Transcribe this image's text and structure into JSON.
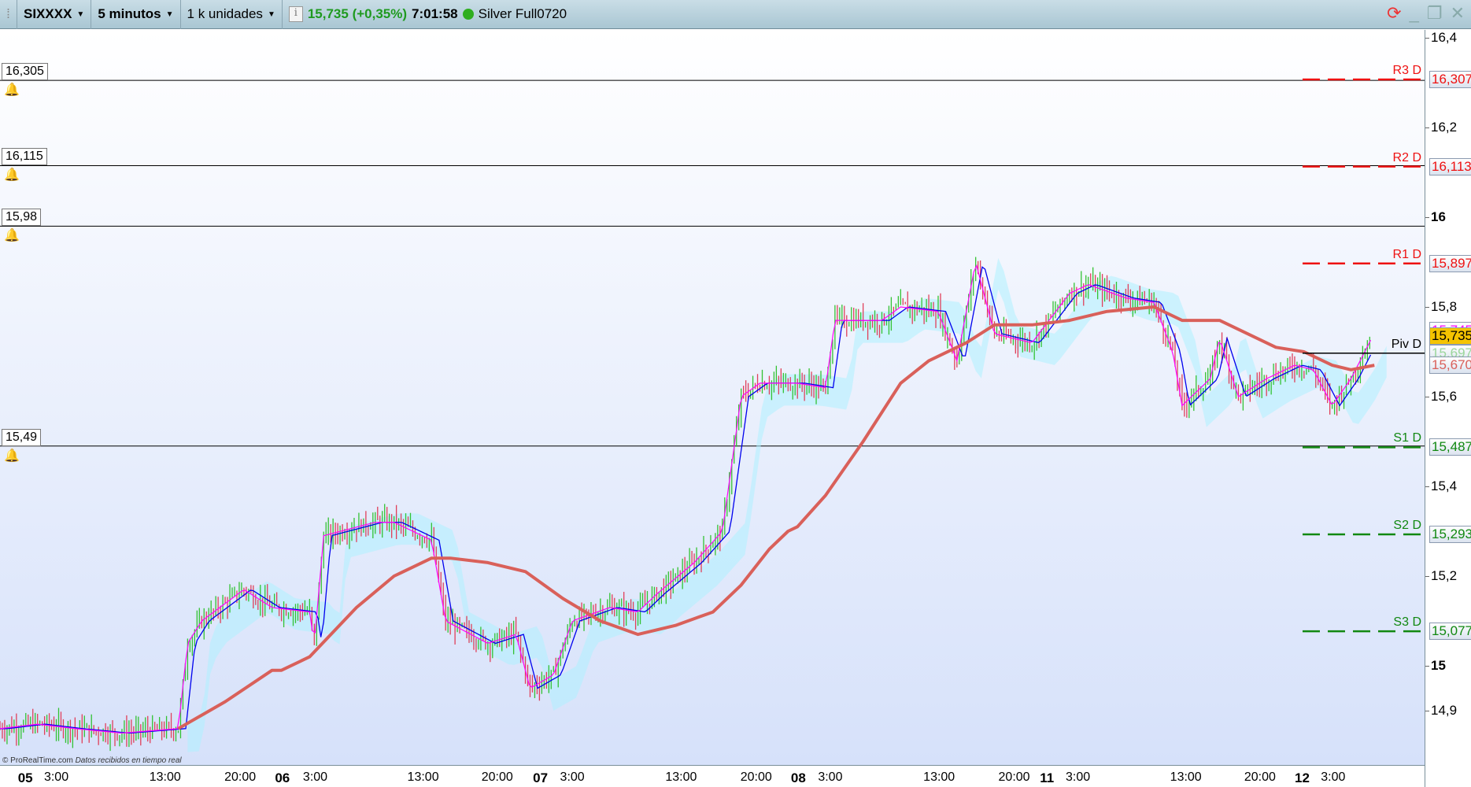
{
  "toolbar": {
    "symbol": "SIXXXX",
    "timeframe": "5 minutos",
    "units": "1 k unidades",
    "price": "15,735 (+0,35%)",
    "time": "7:01:58",
    "feed": "Silver Full0720"
  },
  "footer": {
    "copyright": "© ProRealTime.com",
    "realtime": "Datos recibidos en tiempo real"
  },
  "colors": {
    "up": "#33c233",
    "down": "#e0405a",
    "ma": "#d9605a",
    "fast": "#ff00ff",
    "slow": "#0000ee",
    "cloud": "#aef0ff",
    "resist": "#ee1111",
    "support": "#118811"
  },
  "chart_data": {
    "type": "candlestick",
    "ylim": [
      14.78,
      16.43
    ],
    "xlim": [
      0,
      1510
    ],
    "y_ticks": [
      "16,4",
      "16,2",
      "16",
      "15,8",
      "15,6",
      "15,4",
      "15,2",
      "15",
      "14,9"
    ],
    "y_tick_values": [
      16.4,
      16.2,
      16.0,
      15.8,
      15.6,
      15.4,
      15.2,
      15.0,
      14.9
    ],
    "x_ticks": [
      {
        "label": "05",
        "x": 27,
        "bold": true
      },
      {
        "label": "3:00",
        "x": 60
      },
      {
        "label": "13:00",
        "x": 176
      },
      {
        "label": "20:00",
        "x": 256
      },
      {
        "label": "06",
        "x": 301,
        "bold": true
      },
      {
        "label": "3:00",
        "x": 336
      },
      {
        "label": "13:00",
        "x": 451
      },
      {
        "label": "20:00",
        "x": 530
      },
      {
        "label": "07",
        "x": 576,
        "bold": true
      },
      {
        "label": "3:00",
        "x": 610
      },
      {
        "label": "13:00",
        "x": 726
      },
      {
        "label": "20:00",
        "x": 806
      },
      {
        "label": "08",
        "x": 851,
        "bold": true
      },
      {
        "label": "3:00",
        "x": 885
      },
      {
        "label": "13:00",
        "x": 1001
      },
      {
        "label": "20:00",
        "x": 1081
      },
      {
        "label": "11",
        "x": 1116,
        "bold": true
      },
      {
        "label": "3:00",
        "x": 1149
      },
      {
        "label": "13:00",
        "x": 1264
      },
      {
        "label": "20:00",
        "x": 1343
      },
      {
        "label": "12",
        "x": 1388,
        "bold": true
      },
      {
        "label": "3:00",
        "x": 1421
      }
    ],
    "price_path": [
      [
        0,
        14.86
      ],
      [
        40,
        14.87
      ],
      [
        80,
        14.86
      ],
      [
        130,
        14.85
      ],
      [
        190,
        14.86
      ],
      [
        200,
        15.05
      ],
      [
        215,
        15.1
      ],
      [
        260,
        15.17
      ],
      [
        290,
        15.13
      ],
      [
        330,
        15.12
      ],
      [
        335,
        15.05
      ],
      [
        345,
        15.29
      ],
      [
        400,
        15.32
      ],
      [
        420,
        15.32
      ],
      [
        460,
        15.28
      ],
      [
        475,
        15.1
      ],
      [
        520,
        15.05
      ],
      [
        550,
        15.07
      ],
      [
        565,
        14.95
      ],
      [
        590,
        14.98
      ],
      [
        610,
        15.1
      ],
      [
        650,
        15.13
      ],
      [
        680,
        15.12
      ],
      [
        700,
        15.16
      ],
      [
        740,
        15.23
      ],
      [
        770,
        15.3
      ],
      [
        790,
        15.6
      ],
      [
        810,
        15.63
      ],
      [
        850,
        15.63
      ],
      [
        880,
        15.62
      ],
      [
        890,
        15.77
      ],
      [
        940,
        15.77
      ],
      [
        960,
        15.8
      ],
      [
        1000,
        15.79
      ],
      [
        1020,
        15.68
      ],
      [
        1040,
        15.9
      ],
      [
        1060,
        15.74
      ],
      [
        1100,
        15.72
      ],
      [
        1140,
        15.83
      ],
      [
        1160,
        15.85
      ],
      [
        1200,
        15.82
      ],
      [
        1230,
        15.81
      ],
      [
        1250,
        15.7
      ],
      [
        1260,
        15.58
      ],
      [
        1290,
        15.64
      ],
      [
        1300,
        15.73
      ],
      [
        1320,
        15.6
      ],
      [
        1350,
        15.64
      ],
      [
        1380,
        15.67
      ],
      [
        1400,
        15.66
      ],
      [
        1420,
        15.58
      ],
      [
        1440,
        15.64
      ],
      [
        1462,
        15.73
      ]
    ],
    "moving_average": [
      [
        190,
        14.86
      ],
      [
        240,
        14.92
      ],
      [
        290,
        14.99
      ],
      [
        300,
        14.99
      ],
      [
        330,
        15.02
      ],
      [
        380,
        15.13
      ],
      [
        420,
        15.2
      ],
      [
        460,
        15.24
      ],
      [
        480,
        15.24
      ],
      [
        520,
        15.23
      ],
      [
        560,
        15.21
      ],
      [
        600,
        15.15
      ],
      [
        640,
        15.1
      ],
      [
        680,
        15.07
      ],
      [
        720,
        15.09
      ],
      [
        760,
        15.12
      ],
      [
        790,
        15.18
      ],
      [
        820,
        15.26
      ],
      [
        840,
        15.3
      ],
      [
        850,
        15.31
      ],
      [
        880,
        15.38
      ],
      [
        920,
        15.5
      ],
      [
        960,
        15.63
      ],
      [
        990,
        15.68
      ],
      [
        1030,
        15.72
      ],
      [
        1060,
        15.76
      ],
      [
        1100,
        15.76
      ],
      [
        1140,
        15.77
      ],
      [
        1180,
        15.79
      ],
      [
        1230,
        15.8
      ],
      [
        1260,
        15.77
      ],
      [
        1300,
        15.77
      ],
      [
        1330,
        15.74
      ],
      [
        1360,
        15.71
      ],
      [
        1390,
        15.7
      ],
      [
        1420,
        15.67
      ],
      [
        1440,
        15.66
      ],
      [
        1465,
        15.67
      ]
    ],
    "alert_lines": [
      {
        "label": "16,305",
        "value": 16.305
      },
      {
        "label": "16,115",
        "value": 16.115
      },
      {
        "label": "15,98",
        "value": 15.98
      },
      {
        "label": "15,49",
        "value": 15.49
      }
    ],
    "pivot_levels": [
      {
        "name": "R3 D",
        "label": "16,307",
        "value": 16.307,
        "kind": "resist"
      },
      {
        "name": "R2 D",
        "label": "16,113",
        "value": 16.113,
        "kind": "resist"
      },
      {
        "name": "R1 D",
        "label": "15,897",
        "value": 15.897,
        "kind": "resist"
      },
      {
        "name": "Piv D",
        "label": "15,697",
        "value": 15.697,
        "kind": "pivot"
      },
      {
        "name": "S1 D",
        "label": "15,487",
        "value": 15.487,
        "kind": "support"
      },
      {
        "name": "S2 D",
        "label": "15,293",
        "value": 15.293,
        "kind": "support"
      },
      {
        "name": "S3 D",
        "label": "15,077",
        "value": 15.077,
        "kind": "support"
      }
    ],
    "price_labels": [
      {
        "label": "15,745",
        "value": 15.748,
        "color": "#ff00ff"
      },
      {
        "label": "15,735",
        "value": 15.735,
        "color": "#000",
        "bg": "#f5c400"
      },
      {
        "label": "15,670",
        "value": 15.67,
        "color": "#d9605a"
      }
    ]
  }
}
